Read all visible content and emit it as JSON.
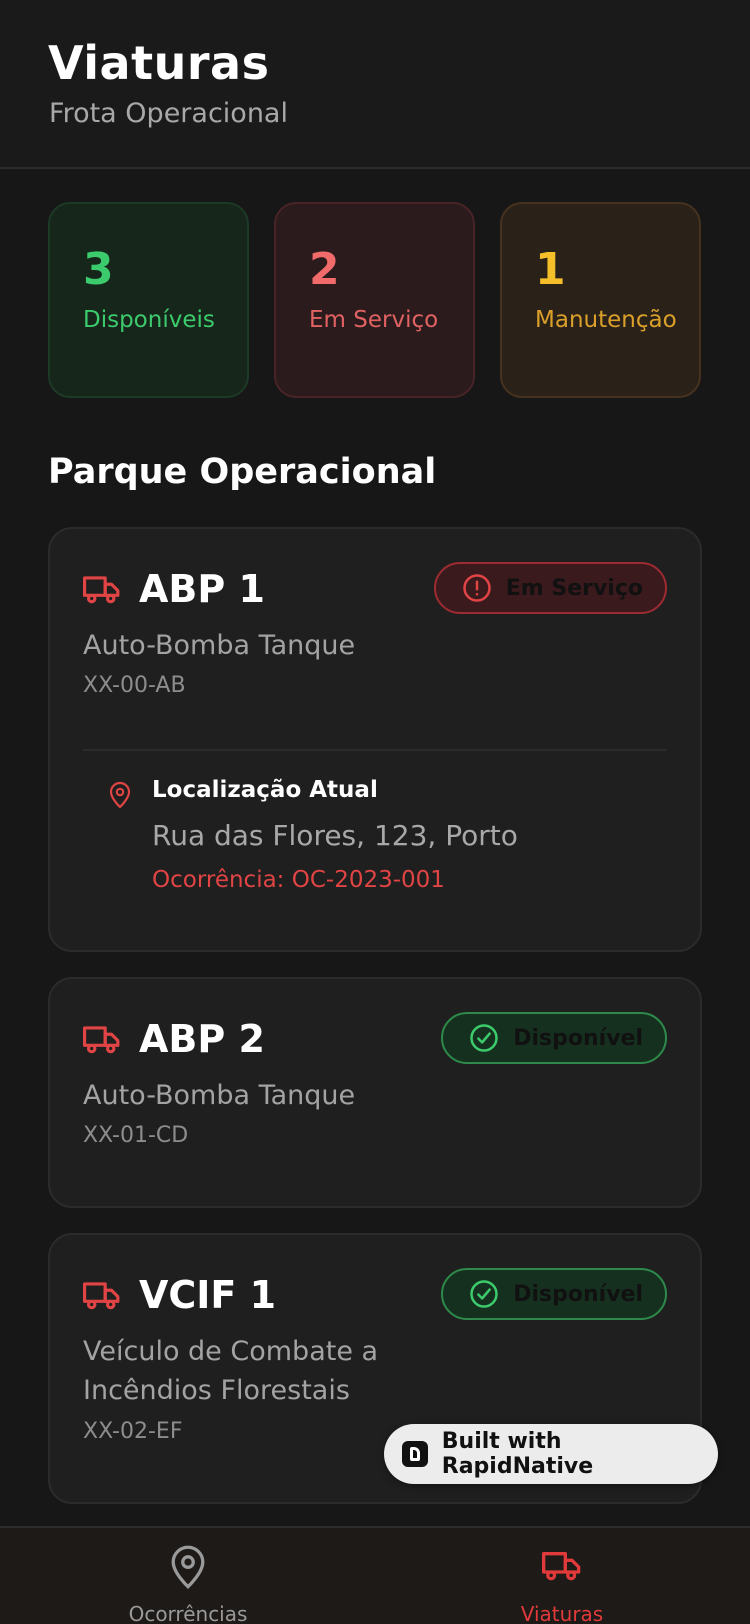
{
  "header": {
    "title": "Viaturas",
    "subtitle": "Frota Operacional"
  },
  "stats": [
    {
      "value": "3",
      "label": "Disponíveis",
      "color": "#3ccb6c"
    },
    {
      "value": "2",
      "label": "Em Serviço",
      "color": "#f26b6b"
    },
    {
      "value": "1",
      "label": "Manutenção",
      "color": "#f5bf2a"
    }
  ],
  "section_title": "Parque Operacional",
  "vehicles": [
    {
      "name": "ABP 1",
      "type": "Auto-Bomba Tanque",
      "plate": "XX-00-AB",
      "status": "Em Serviço",
      "status_icon": "alert-circle-icon",
      "location": {
        "title": "Localização Atual",
        "address": "Rua das Flores, 123, Porto",
        "occurrence": "Ocorrência: OC-2023-001"
      }
    },
    {
      "name": "ABP 2",
      "type": "Auto-Bomba Tanque",
      "plate": "XX-01-CD",
      "status": "Disponível",
      "status_icon": "check-circle-icon"
    },
    {
      "name": "VCIF 1",
      "type": "Veículo de Combate a Incêndios Florestais",
      "plate": "XX-02-EF",
      "status": "Disponível",
      "status_icon": "check-circle-icon"
    }
  ],
  "built_with": "Built with RapidNative",
  "tabs": [
    {
      "label": "Ocorrências",
      "icon": "map-pin-icon",
      "active": false
    },
    {
      "label": "Viaturas",
      "icon": "truck-icon",
      "active": true
    }
  ],
  "colors": {
    "accent": "#e03a3a",
    "background": "#171717"
  }
}
